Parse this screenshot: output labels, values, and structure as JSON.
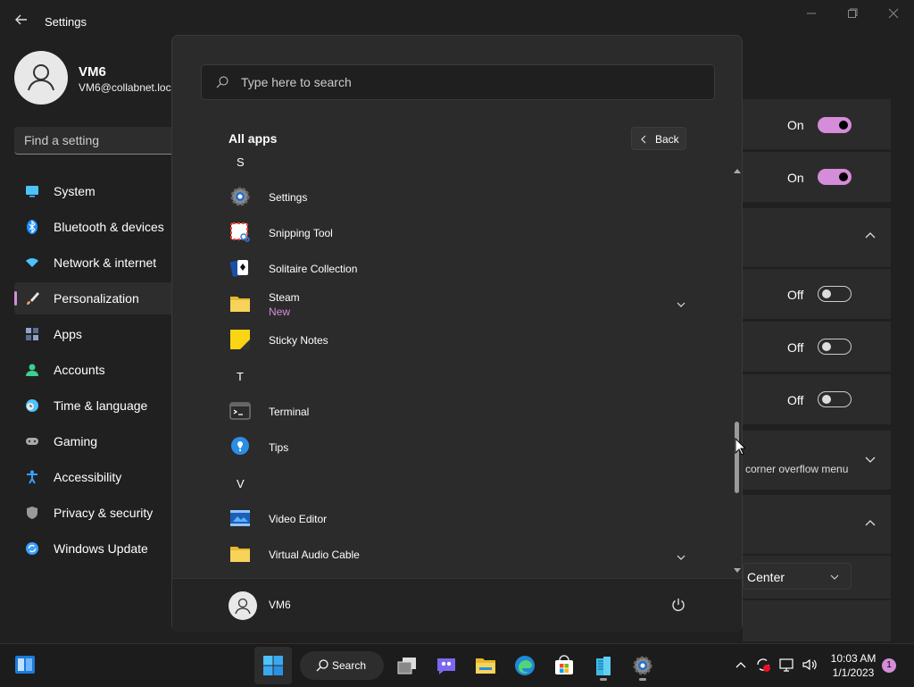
{
  "settings": {
    "title": "Settings",
    "user": {
      "name": "VM6",
      "email": "VM6@collabnet.loc"
    },
    "search_placeholder": "Find a setting",
    "nav": [
      {
        "label": "System",
        "icon": "monitor-icon",
        "color": "#4cc2ff"
      },
      {
        "label": "Bluetooth & devices",
        "icon": "bluetooth-icon",
        "color": "#1e90ff"
      },
      {
        "label": "Network & internet",
        "icon": "wifi-icon",
        "color": "#4cc2ff"
      },
      {
        "label": "Personalization",
        "icon": "brush-icon",
        "color": "#f29b6b",
        "active": true
      },
      {
        "label": "Apps",
        "icon": "apps-icon",
        "color": "#8ea5c8"
      },
      {
        "label": "Accounts",
        "icon": "person-icon",
        "color": "#3ccf91"
      },
      {
        "label": "Time & language",
        "icon": "clock-globe-icon",
        "color": "#4cc2ff"
      },
      {
        "label": "Gaming",
        "icon": "gamepad-icon",
        "color": "#aaaaaa"
      },
      {
        "label": "Accessibility",
        "icon": "accessibility-icon",
        "color": "#3aa0ff"
      },
      {
        "label": "Privacy & security",
        "icon": "shield-icon",
        "color": "#9a9a9a"
      },
      {
        "label": "Windows Update",
        "icon": "refresh-icon",
        "color": "#3aa0ff"
      }
    ],
    "right_panel": {
      "toggles": [
        {
          "state_label": "On",
          "on": true
        },
        {
          "state_label": "On",
          "on": true
        },
        {
          "state_label": "Off",
          "on": false
        },
        {
          "state_label": "Off",
          "on": false
        },
        {
          "state_label": "Off",
          "on": false
        }
      ],
      "overflow_text": "corner overflow menu",
      "alignment_value": "Center"
    }
  },
  "start_menu": {
    "search_placeholder": "Type here to search",
    "heading": "All apps",
    "back_label": "Back",
    "items": [
      {
        "type": "letter",
        "text": "S"
      },
      {
        "type": "app",
        "name": "Settings",
        "icon": "settings-gear-icon"
      },
      {
        "type": "app",
        "name": "Snipping Tool",
        "icon": "snipping-tool-icon"
      },
      {
        "type": "app",
        "name": "Solitaire Collection",
        "icon": "solitaire-icon"
      },
      {
        "type": "folder",
        "name": "Steam",
        "sub": "New",
        "icon": "folder-icon"
      },
      {
        "type": "app",
        "name": "Sticky Notes",
        "icon": "sticky-notes-icon"
      },
      {
        "type": "letter",
        "text": "T"
      },
      {
        "type": "app",
        "name": "Terminal",
        "icon": "terminal-icon"
      },
      {
        "type": "app",
        "name": "Tips",
        "icon": "tips-bulb-icon"
      },
      {
        "type": "letter",
        "text": "V"
      },
      {
        "type": "app",
        "name": "Video Editor",
        "icon": "video-editor-icon"
      },
      {
        "type": "folder",
        "name": "Virtual Audio Cable",
        "icon": "folder-icon"
      }
    ],
    "footer_user": "VM6"
  },
  "taskbar": {
    "search_label": "Search",
    "time": "10:03 AM",
    "date": "1/1/2023",
    "notification_count": "1",
    "accent": "#d58cd9"
  }
}
